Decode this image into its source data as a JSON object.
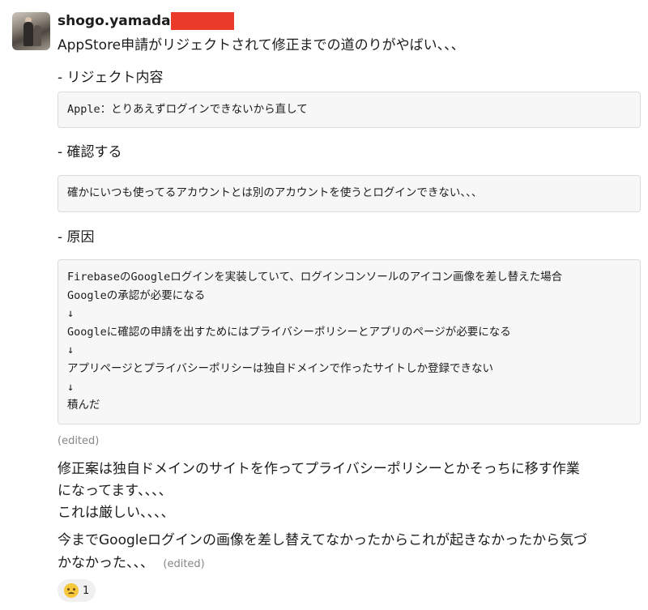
{
  "message": {
    "username": "shogo.yamada",
    "intro": "AppStore申請がリジェクトされて修正までの道のりがやばい、、、",
    "sections": [
      {
        "heading": "- リジェクト内容",
        "code_lines": [
          "Apple：とりあえずログインできないから直して"
        ]
      },
      {
        "heading": "- 確認する",
        "code_lines": [
          "確かにいつも使ってるアカウントとは別のアカウントを使うとログインできない、、、"
        ]
      },
      {
        "heading": "- 原因",
        "code_lines": [
          "FirebaseのGoogleログインを実装していて、ログインコンソールのアイコン画像を差し替えた場合",
          "Googleの承認が必要になる",
          "↓",
          "Googleに確認の申請を出すためにはプライバシーポリシーとアプリのページが必要になる",
          "↓",
          "アプリページとプライバシーポリシーは独自ドメインで作ったサイトしか登録できない",
          "↓",
          "積んだ"
        ]
      }
    ],
    "edited_label": "(edited)",
    "followups": [
      "修正案は独自ドメインのサイトを作ってプライバシーポリシーとかそっちに移す作業",
      "になってます、、、、",
      "これは厳しい、、、、",
      "今までGoogleログインの画像を差し替えてなかったからこれが起きなかったから気づ",
      "かなかった、、、"
    ],
    "followup_edited_label": "(edited)",
    "reaction": {
      "emoji": "sweat-smile-face",
      "count": "1"
    }
  },
  "colors": {
    "redaction": "#ea3b2a",
    "code_bg": "#f7f7f7",
    "muted": "#868686"
  }
}
